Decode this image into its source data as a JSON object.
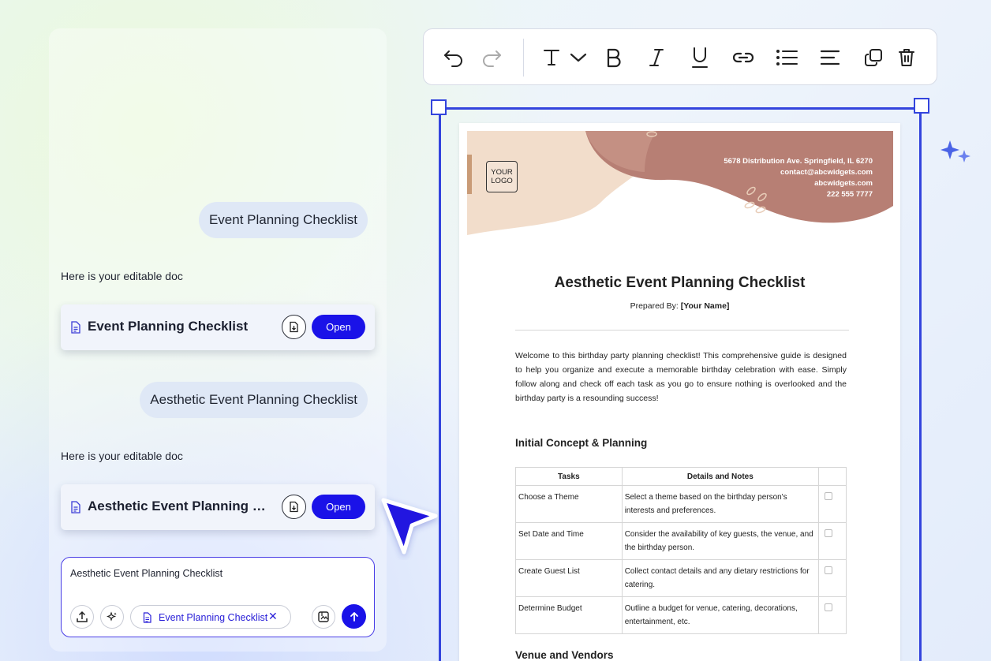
{
  "chat": {
    "messages": [
      {
        "role": "user",
        "text": "Event Planning Checklist"
      },
      {
        "role": "assistant",
        "text": "Here is your editable doc",
        "doc_title": "Event Planning Checklist",
        "open_label": "Open"
      },
      {
        "role": "user",
        "text": "Aesthetic Event Planning Checklist"
      },
      {
        "role": "assistant",
        "text": "Here is your editable doc",
        "doc_title": "Aesthetic Event Planning Checklist",
        "open_label": "Open"
      }
    ],
    "input": {
      "value": "Aesthetic Event Planning Checklist",
      "attachment_chip": "Event Planning Checklist"
    }
  },
  "toolbar": {
    "icons": [
      "undo-icon",
      "redo-icon",
      "text-style-icon",
      "chevron-down-icon",
      "bold-icon",
      "italic-icon",
      "underline-icon",
      "link-icon",
      "bullet-list-icon",
      "align-left-icon",
      "duplicate-icon",
      "delete-icon"
    ]
  },
  "document": {
    "logo": [
      "YOUR",
      "LOGO"
    ],
    "contact": [
      "5678 Distribution Ave. Springfield, IL 6270",
      "contact@abcwidgets.com",
      "abcwidgets.com",
      "222 555 7777"
    ],
    "title": "Aesthetic Event Planning Checklist",
    "prepared_label": "Prepared By:",
    "prepared_value": "[Your Name]",
    "intro": "Welcome to this birthday party planning checklist! This comprehensive guide is designed to help you organize and execute a memorable birthday celebration with ease. Simply follow along and check off each task as you go to ensure nothing is overlooked and the birthday party is a resounding success!",
    "sections": [
      {
        "heading": "Initial Concept & Planning",
        "columns": [
          "Tasks",
          "Details and Notes",
          ""
        ],
        "rows": [
          {
            "task": "Choose a Theme",
            "details": "Select a theme based on the birthday person's interests and preferences."
          },
          {
            "task": "Set Date and Time",
            "details": "Consider the availability of key guests, the venue, and the birthday person."
          },
          {
            "task": "Create Guest List",
            "details": "Collect contact details and any dietary restrictions for catering."
          },
          {
            "task": "Determine Budget",
            "details": "Outline a budget for venue, catering, decorations, entertainment, etc."
          }
        ]
      },
      {
        "heading": "Venue and Vendors"
      }
    ]
  },
  "colors": {
    "accent": "#1a12e8",
    "selection": "#3344dd",
    "banner_mauve": "#b57c72",
    "banner_peach": "#f1ddcc"
  }
}
